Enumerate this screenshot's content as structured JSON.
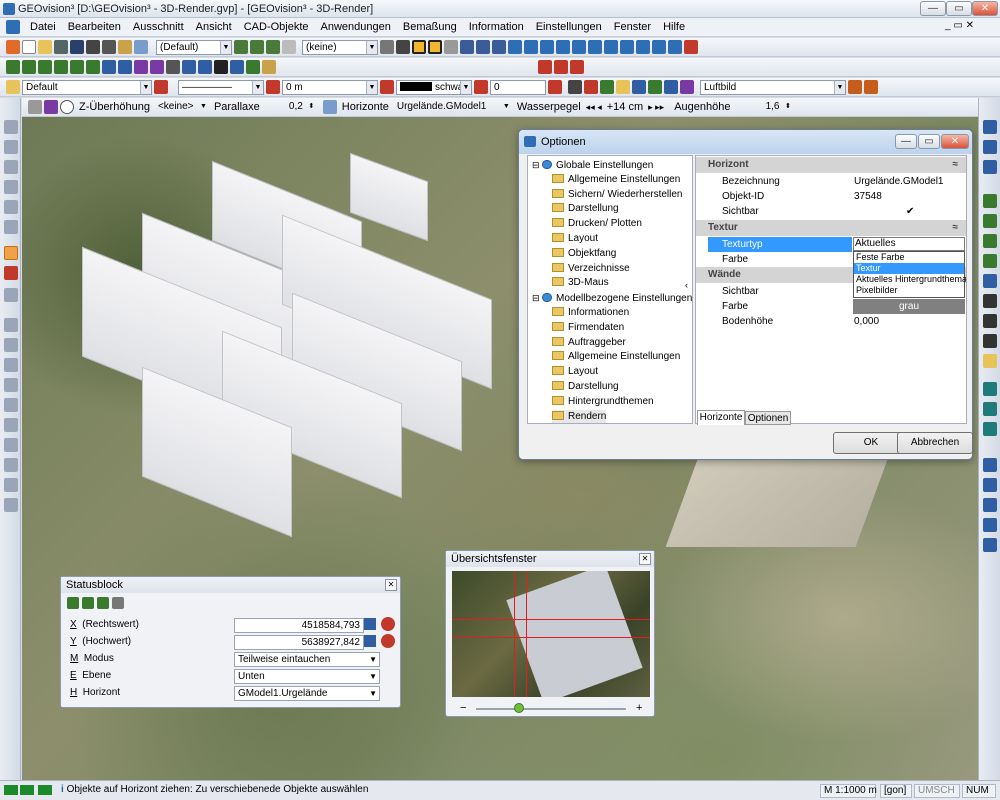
{
  "window": {
    "title": "GEOvision³ [D:\\GEOvision³ - 3D-Render.gvp] - [GEOvision³ - 3D-Render]",
    "min": "—",
    "max": "▭",
    "close": "✕"
  },
  "menu": [
    "Datei",
    "Bearbeiten",
    "Ausschnitt",
    "Ansicht",
    "CAD-Objekte",
    "Anwendungen",
    "Bemaßung",
    "Information",
    "Einstellungen",
    "Fenster",
    "Hilfe"
  ],
  "toolbar1": {
    "layer_select": "(Default)",
    "filter_select": "(keine)"
  },
  "toolbar3": {
    "style_select": "Default",
    "linetype": "—————",
    "width_value": "0 m",
    "color_name": "schwarz",
    "offset_value": "0",
    "background_select": "Luftbild"
  },
  "toolbar4": {
    "z_label": "Z-Überhöhung",
    "z_value": "<keine>",
    "parallax_label": "Parallaxe",
    "parallax_value": "0,2",
    "horizont_label": "Horizonte",
    "horizont_value": "Urgelände.GModel1",
    "wasser_label": "Wasserpegel",
    "wasser_value": "+14 cm",
    "augen_label": "Augenhöhe",
    "augen_value": "1,6"
  },
  "options": {
    "title": "Optionen",
    "tree": [
      {
        "label": "Globale Einstellungen",
        "level": 0
      },
      {
        "label": "Allgemeine Einstellungen",
        "level": 1
      },
      {
        "label": "Sichern/ Wiederherstellen",
        "level": 1
      },
      {
        "label": "Darstellung",
        "level": 1
      },
      {
        "label": "Drucken/ Plotten",
        "level": 1
      },
      {
        "label": "Layout",
        "level": 1
      },
      {
        "label": "Objektfang",
        "level": 1
      },
      {
        "label": "Verzeichnisse",
        "level": 1
      },
      {
        "label": "3D-Maus",
        "level": 1
      },
      {
        "label": "Modellbezogene Einstellungen",
        "level": 0
      },
      {
        "label": "Informationen",
        "level": 1
      },
      {
        "label": "Firmendaten",
        "level": 1
      },
      {
        "label": "Auftraggeber",
        "level": 1
      },
      {
        "label": "Allgemeine Einstellungen",
        "level": 1
      },
      {
        "label": "Layout",
        "level": 1
      },
      {
        "label": "Darstellung",
        "level": 1
      },
      {
        "label": "Hintergrundthemen",
        "level": 1
      },
      {
        "label": "Rendern",
        "level": 1
      }
    ],
    "cat_horizont": "Horizont",
    "bez_k": "Bezeichnung",
    "bez_v": "Urgelände.GModel1",
    "id_k": "Objekt-ID",
    "id_v": "37548",
    "sicht_k": "Sichtbar",
    "sicht_v": "✔",
    "cat_textur": "Textur",
    "typ_k": "Texturtyp",
    "typ_v": "Aktuelles Hintergrundthem",
    "farbe_k": "Farbe",
    "dropdown": [
      "Feste Farbe",
      "Textur",
      "Aktuelles Hintergrundthema",
      "Pixelbilder"
    ],
    "cat_waende": "Wände",
    "w_sicht_k": "Sichtbar",
    "w_farbe_k": "Farbe",
    "w_farbe_v": "grau",
    "boden_k": "Bodenhöhe",
    "boden_v": "0,000",
    "tab1": "Horizonte",
    "tab2": "Optionen",
    "ok": "OK",
    "cancel": "Abbrechen",
    "collapse": "≈"
  },
  "statusblock": {
    "title": "Statusblock",
    "rows": [
      {
        "key": "X",
        "label": "(Rechtswert)",
        "value": "4518584,793"
      },
      {
        "key": "Y",
        "label": "(Hochwert)",
        "value": "5638927,842"
      },
      {
        "key": "M",
        "label": "Modus",
        "value": "Teilweise eintauchen"
      },
      {
        "key": "E",
        "label": "Ebene",
        "value": "Unten"
      },
      {
        "key": "H",
        "label": "Horizont",
        "value": "GModel1.Urgelände"
      }
    ]
  },
  "overview": {
    "title": "Übersichtsfenster",
    "minus": "−",
    "plus": "+"
  },
  "statusbar": {
    "message": "Objekte auf Horizont ziehen: Zu verschiebenede Objekte auswählen",
    "scale": "M 1:1000 m",
    "unit": "[gon]",
    "umsch": "UMSCH",
    "num": "NUM"
  }
}
